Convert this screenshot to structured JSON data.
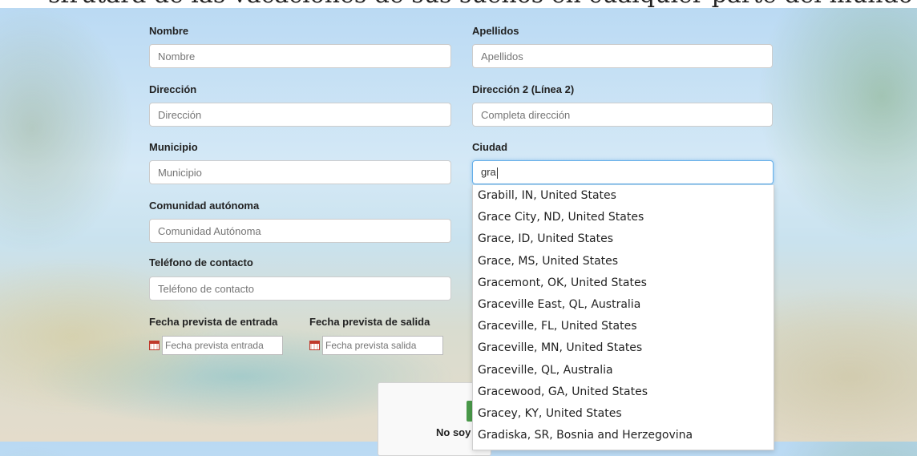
{
  "header": {
    "partial_title": "sfrutará de las vacaciones de sus sueños en cualquier parte del mundo"
  },
  "form": {
    "nombre": {
      "label": "Nombre",
      "placeholder": "Nombre"
    },
    "apellidos": {
      "label": "Apellidos",
      "placeholder": "Apellidos"
    },
    "direccion": {
      "label": "Dirección",
      "placeholder": "Dirección"
    },
    "direccion2": {
      "label": "Dirección 2 (Línea 2)",
      "placeholder": "Completa dirección"
    },
    "municipio": {
      "label": "Municipio",
      "placeholder": "Municipio"
    },
    "ciudad": {
      "label": "Ciudad",
      "value": "gra"
    },
    "comunidad": {
      "label": "Comunidad autónoma",
      "placeholder": "Comunidad Autónoma"
    },
    "telefono": {
      "label": "Teléfono de contacto",
      "placeholder": "Teléfono de contacto"
    },
    "fecha_entrada": {
      "label": "Fecha prevista de entrada",
      "placeholder": "Fecha prevista entrada"
    },
    "fecha_salida": {
      "label": "Fecha prevista de salida",
      "placeholder": "Fecha prevista salida"
    }
  },
  "autocomplete": [
    "Grabill, IN, United States",
    "Grace City, ND, United States",
    "Grace, ID, United States",
    "Grace, MS, United States",
    "Gracemont, OK, United States",
    "Graceville East, QL, Australia",
    "Graceville, FL, United States",
    "Graceville, MN, United States",
    "Graceville, QL, Australia",
    "Gracewood, GA, United States",
    "Gracey, KY, United States",
    "Gradiska, SR, Bosnia and Herzegovina"
  ],
  "captcha": {
    "partial_text": "No soy"
  },
  "colors": {
    "focus": "#66afe9",
    "calendar_icon": "#c0392b",
    "captcha_check": "#4a9a4a"
  },
  "icons": {
    "date": "calendar-icon"
  }
}
